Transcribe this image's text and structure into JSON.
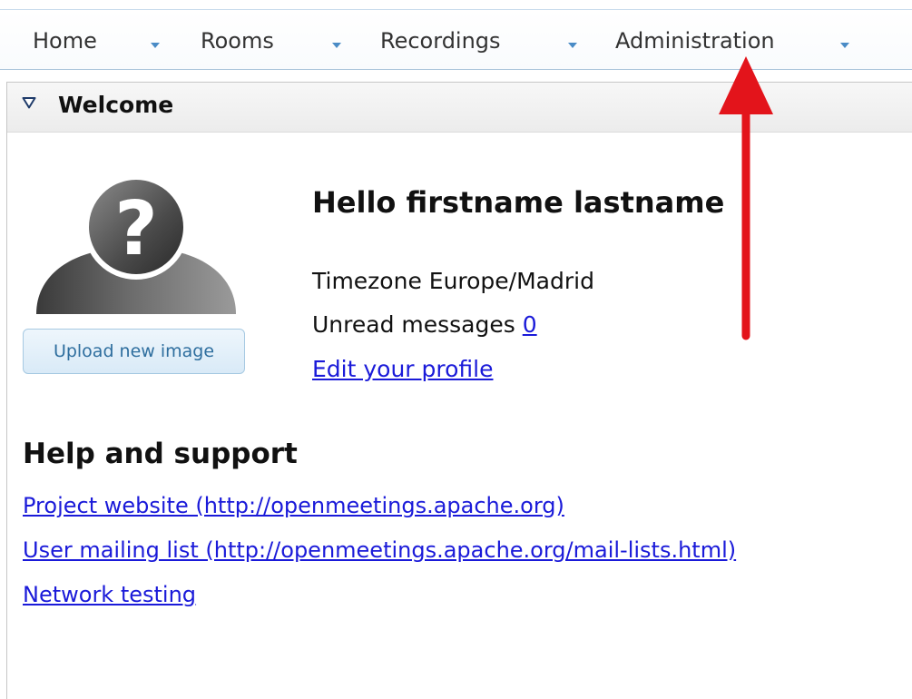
{
  "nav": {
    "items": [
      {
        "label": "Home"
      },
      {
        "label": "Rooms"
      },
      {
        "label": "Recordings"
      },
      {
        "label": "Administration"
      }
    ]
  },
  "panel": {
    "title": "Welcome"
  },
  "profile": {
    "greeting": "Hello firstname lastname",
    "timezone": "Timezone Europe/Madrid",
    "unread_label": "Unread messages",
    "unread_count": "0",
    "edit_profile": "Edit your profile",
    "upload_button": "Upload new image"
  },
  "help": {
    "title": "Help and support",
    "links": [
      {
        "label": "Project website (http://openmeetings.apache.org)"
      },
      {
        "label": "User mailing list (http://openmeetings.apache.org/mail-lists.html)"
      },
      {
        "label": "Network testing"
      }
    ]
  },
  "colors": {
    "annotation_arrow": "#e3141b",
    "link": "#1a1ad9",
    "nav_caret": "#4a8bc6"
  },
  "icons": {
    "avatar": "unknown-user-avatar",
    "collapse": "triangle-down-icon",
    "annotation": "red-arrow-up"
  }
}
